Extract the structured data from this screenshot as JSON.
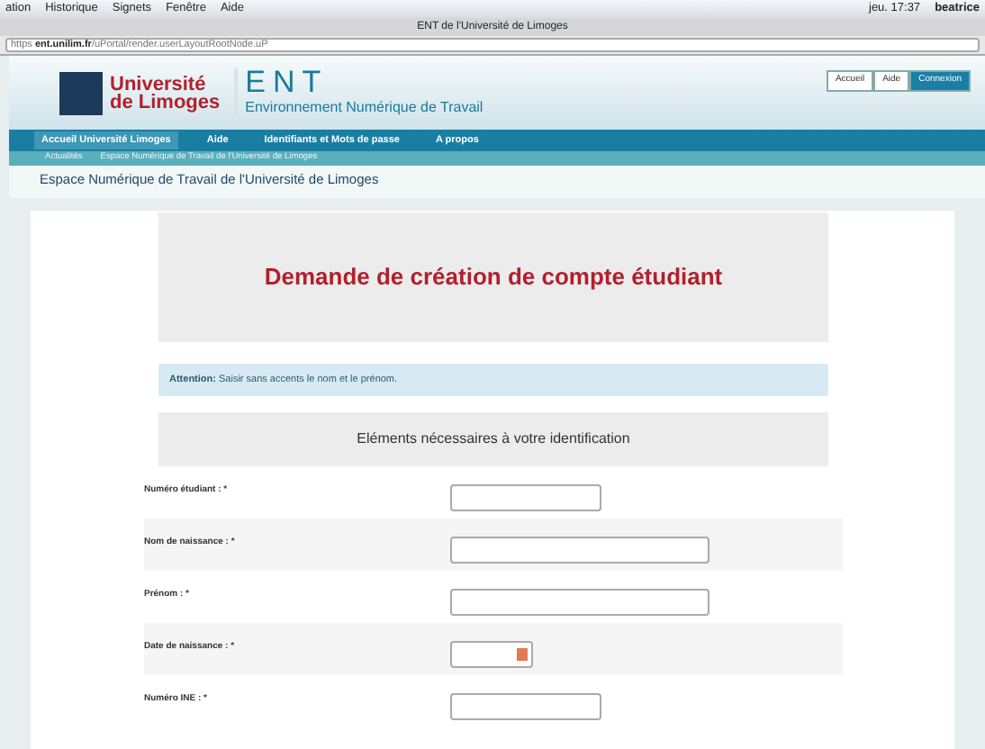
{
  "menubar": {
    "items": [
      "ation",
      "Historique",
      "Signets",
      "Fenêtre",
      "Aide"
    ],
    "clock": "jeu. 17:37",
    "user": "beatrice"
  },
  "window": {
    "title": "ENT de l'Université de Limoges"
  },
  "address_bar": {
    "scheme": "https",
    "host": "ent.unilim.fr",
    "path": "/uPortal/render.userLayoutRootNode.uP"
  },
  "header": {
    "logo_line_1": "Université",
    "logo_line_2": "de Limoges",
    "ent": "ENT",
    "subtitle": "Environnement Numérique de Travail",
    "buttons": [
      {
        "label": "Accueil",
        "selected": false
      },
      {
        "label": "Aide",
        "selected": false
      },
      {
        "label": "Connexion",
        "selected": true
      }
    ]
  },
  "nav": [
    {
      "label": "Accueil Université Limoges",
      "selected": true
    },
    {
      "label": "Aide",
      "selected": false
    },
    {
      "label": "Identifiants et Mots de passe",
      "selected": false
    },
    {
      "label": "A propos",
      "selected": false
    }
  ],
  "subnav": [
    "Actualités",
    "Espace Numérique de Travail de l'Université de Limoges"
  ],
  "page_title": "Espace Numérique de Travail de l'Université de Limoges",
  "form": {
    "title": "Demande de création de compte étudiant",
    "alert": "**Attention:** Saisir sans accents le nom et le prénom.",
    "section": "Eléments nécessaires à votre identification",
    "fields": [
      {
        "label": "Numéro étudiant : *",
        "kind": "short"
      },
      {
        "label": "Nom de naissance : *",
        "kind": "long"
      },
      {
        "label": "Prénom : *",
        "kind": "long"
      },
      {
        "label": "Date de naissance : *",
        "kind": "date"
      },
      {
        "label": "Numéro INE : *",
        "kind": "short"
      }
    ]
  }
}
